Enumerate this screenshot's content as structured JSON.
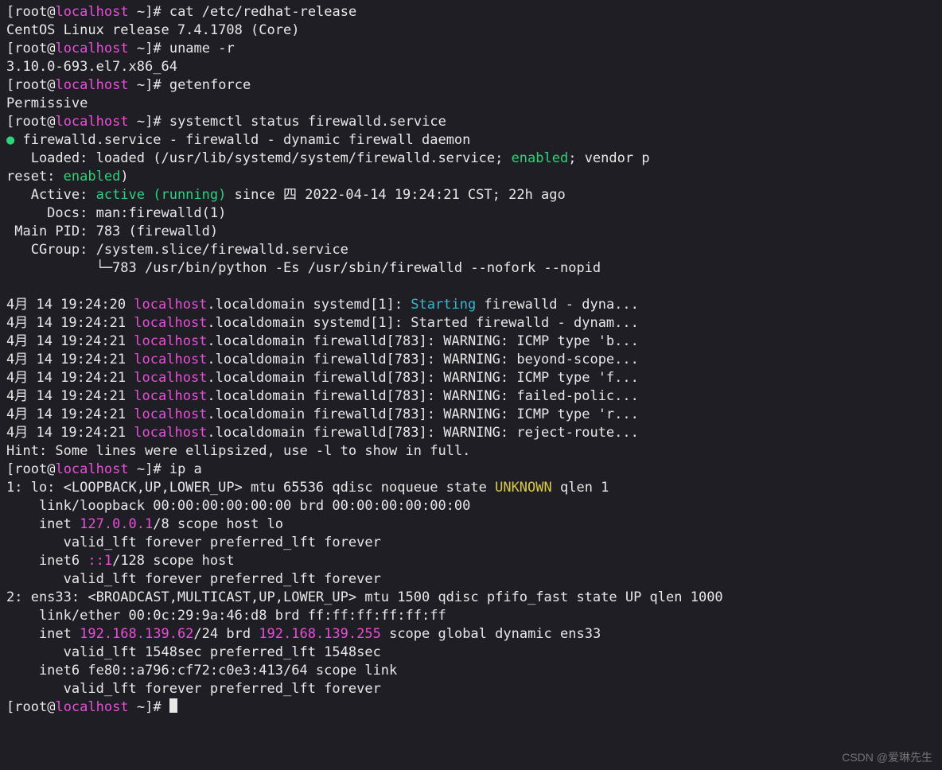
{
  "prompt": {
    "user": "root",
    "host": "localhost",
    "cwd": "~",
    "sigil": "#"
  },
  "cmds": {
    "cat": "cat /etc/redhat-release",
    "uname": "uname -r",
    "getenforce": "getenforce",
    "systemctl": "systemctl status firewalld.service",
    "ipa": "ip a",
    "empty": ""
  },
  "out": {
    "release": "CentOS Linux release 7.4.1708 (Core)",
    "kernel": "3.10.0-693.el7.x86_64",
    "selinux": "Permissive",
    "svc_title": " firewalld.service - firewalld - dynamic firewall daemon",
    "loaded_a": "   Loaded: loaded (/usr/lib/systemd/system/firewalld.service; ",
    "enabled": "enabled",
    "loaded_b": "; vendor p",
    "reset_a": "reset: ",
    "reset_b": ")",
    "active_a": "   Active: ",
    "active_v": "active (running)",
    "active_b": " since 四 2022-04-14 19:24:21 CST; 22h ago",
    "docs": "     Docs: man:firewalld(1)",
    "mainpid": " Main PID: 783 (firewalld)",
    "cgroup": "   CGroup: /system.slice/firewalld.service",
    "cgline": "           └─783 /usr/bin/python -Es /usr/sbin/firewalld --nofork --nopid",
    "hint": "Hint: Some lines were ellipsized, use -l to show in full."
  },
  "logs": [
    {
      "ts": "4月 14 19:24:20 ",
      "host": "localhost",
      "rest": ".localdomain systemd[1]: ",
      "starting": "Starting",
      "tail": " firewalld - dyna..."
    },
    {
      "ts": "4月 14 19:24:21 ",
      "host": "localhost",
      "rest": ".localdomain systemd[1]: Started firewalld - dynam..."
    },
    {
      "ts": "4月 14 19:24:21 ",
      "host": "localhost",
      "rest": ".localdomain firewalld[783]: WARNING: ICMP type 'b..."
    },
    {
      "ts": "4月 14 19:24:21 ",
      "host": "localhost",
      "rest": ".localdomain firewalld[783]: WARNING: beyond-scope..."
    },
    {
      "ts": "4月 14 19:24:21 ",
      "host": "localhost",
      "rest": ".localdomain firewalld[783]: WARNING: ICMP type 'f..."
    },
    {
      "ts": "4月 14 19:24:21 ",
      "host": "localhost",
      "rest": ".localdomain firewalld[783]: WARNING: failed-polic..."
    },
    {
      "ts": "4月 14 19:24:21 ",
      "host": "localhost",
      "rest": ".localdomain firewalld[783]: WARNING: ICMP type 'r..."
    },
    {
      "ts": "4月 14 19:24:21 ",
      "host": "localhost",
      "rest": ".localdomain firewalld[783]: WARNING: reject-route..."
    }
  ],
  "ip": {
    "lo_hdr_a": "1: lo: <LOOPBACK,UP,LOWER_UP> mtu 65536 qdisc noqueue state ",
    "unknown": "UNKNOWN",
    "lo_hdr_b": " qlen 1",
    "lo_link": "    link/loopback 00:00:00:00:00:00 brd 00:00:00:00:00:00",
    "lo_in_a": "    inet ",
    "lo_ip": "127.0.0.1",
    "lo_in_b": "/8 scope host lo",
    "lft": "       valid_lft forever preferred_lft forever",
    "lo6_a": "    inet6 ",
    "lo6_ip": "::1",
    "lo6_b": "/128 scope host",
    "ens_hdr": "2: ens33: <BROADCAST,MULTICAST,UP,LOWER_UP> mtu 1500 qdisc pfifo_fast state UP qlen 1000",
    "ens_link": "    link/ether 00:0c:29:9a:46:d8 brd ff:ff:ff:ff:ff:ff",
    "ens_in_a": "    inet ",
    "ens_ip": "192.168.139.62",
    "ens_in_b": "/24 brd ",
    "ens_brd": "192.168.139.255",
    "ens_in_c": " scope global dynamic ens33",
    "ens_lft": "       valid_lft 1548sec preferred_lft 1548sec",
    "ens6": "    inet6 fe80::a796:cf72:c0e3:413/64 scope link"
  },
  "watermark": "CSDN @爱琳先生"
}
